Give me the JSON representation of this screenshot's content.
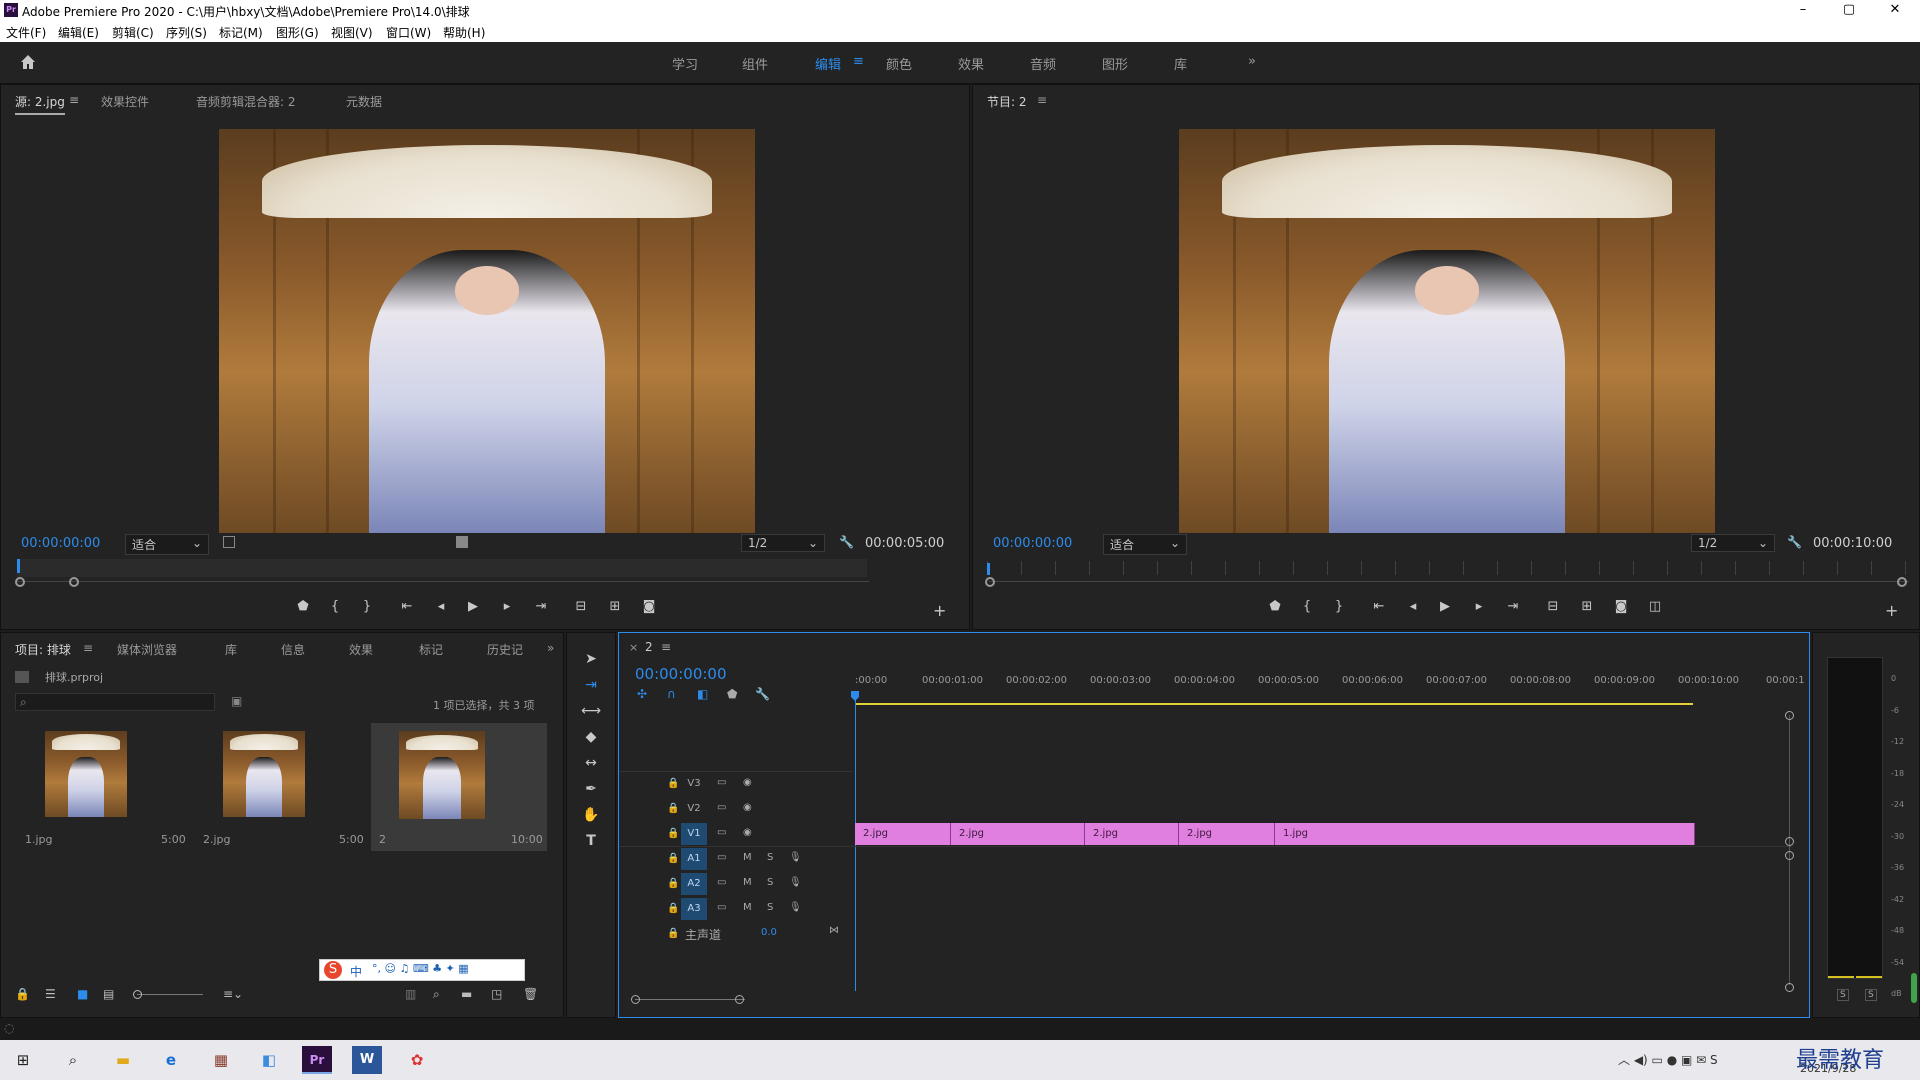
{
  "titlebar": {
    "title": "Adobe Premiere Pro 2020 - C:\\用户\\hbxy\\文档\\Adobe\\Premiere Pro\\14.0\\排球",
    "minimize": "–",
    "maximize": "▢",
    "close": "✕"
  },
  "menu": [
    "文件(F)",
    "编辑(E)",
    "剪辑(C)",
    "序列(S)",
    "标记(M)",
    "图形(G)",
    "视图(V)",
    "窗口(W)",
    "帮助(H)"
  ],
  "workspaces": {
    "home_icon": "home-icon",
    "items": [
      {
        "label": "学习"
      },
      {
        "label": "组件"
      },
      {
        "label": "编辑",
        "active": true
      },
      {
        "label": "颜色"
      },
      {
        "label": "效果"
      },
      {
        "label": "音频"
      },
      {
        "label": "图形"
      },
      {
        "label": "库"
      }
    ],
    "more": "»"
  },
  "source": {
    "tabs": [
      "源: 2.jpg",
      "效果控件",
      "音频剪辑混合器: 2",
      "元数据"
    ],
    "timecode": "00:00:00:00",
    "zoom": "适合",
    "resolution": "1/2",
    "duration": "00:00:05:00"
  },
  "program": {
    "tab": "节目: 2",
    "timecode": "00:00:00:00",
    "zoom": "适合",
    "resolution": "1/2",
    "duration": "00:00:10:00"
  },
  "project": {
    "tabs": [
      "项目: 排球",
      "媒体浏览器",
      "库",
      "信息",
      "效果",
      "标记",
      "历史记"
    ],
    "file": "排球.prproj",
    "search_placeholder": "",
    "selection": "1 项已选择，共 3 项",
    "items": [
      {
        "name": "1.jpg",
        "dur": "5:00"
      },
      {
        "name": "2.jpg",
        "dur": "5:00"
      },
      {
        "name": "2",
        "dur": "10:00"
      }
    ]
  },
  "timeline": {
    "tab": "2",
    "timecode": "00:00:00:00",
    "ruler": [
      ":00:00",
      "00:00:01:00",
      "00:00:02:00",
      "00:00:03:00",
      "00:00:04:00",
      "00:00:05:00",
      "00:00:06:00",
      "00:00:07:00",
      "00:00:08:00",
      "00:00:09:00",
      "00:00:10:00",
      "00:00:1"
    ],
    "tracks": [
      {
        "id": "V3",
        "type": "video"
      },
      {
        "id": "V2",
        "type": "video"
      },
      {
        "id": "V1",
        "type": "video",
        "on": true
      },
      {
        "id": "A1",
        "type": "audio",
        "on": true
      },
      {
        "id": "A2",
        "type": "audio",
        "on": true
      },
      {
        "id": "A3",
        "type": "audio",
        "on": true
      }
    ],
    "master": {
      "label": "主声道",
      "value": "0.0"
    },
    "clips": [
      "2.jpg",
      "2.jpg",
      "2.jpg",
      "2.jpg",
      "1.jpg"
    ],
    "m": "M",
    "s": "S"
  },
  "meter": {
    "scale": [
      "0",
      "-6",
      "-12",
      "-18",
      "-24",
      "-30",
      "-36",
      "-42",
      "-48",
      "-54",
      "dB"
    ],
    "solo": [
      "S",
      "S"
    ]
  },
  "ime": {
    "label": "中"
  },
  "taskbar": {
    "date": "2021/9/28",
    "watermark": "最需教育"
  },
  "colors": {
    "accent": "#2d8ceb",
    "clip": "#e07fe0",
    "workarea": "#e3d13a"
  }
}
